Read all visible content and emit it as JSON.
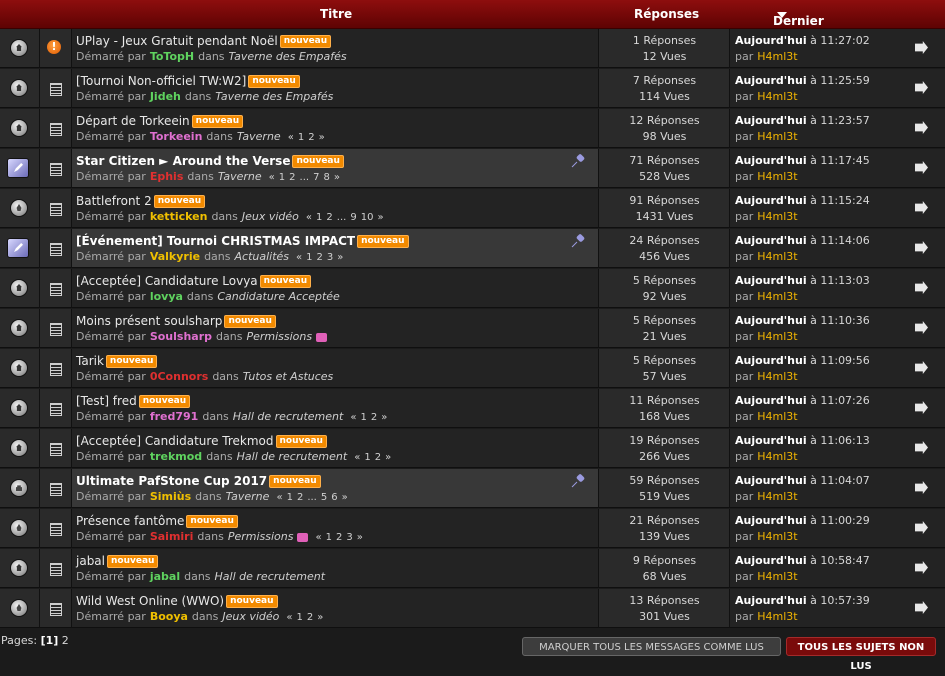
{
  "header": {
    "title": "Titre",
    "replies": "Réponses",
    "last": "Dernier message"
  },
  "labels": {
    "started_by": "Démarré par",
    "in": "dans",
    "new_badge": "nouveau",
    "today": "Aujourd'hui",
    "at": "à",
    "by": "par"
  },
  "colors": {
    "green": "#5fd35f",
    "pink": "#e070d0",
    "red": "#e03030",
    "yellow": "#f0c000",
    "gold": "#f0b400"
  },
  "topics": [
    {
      "title": "UPlay - Jeux Gratuit pendant Noël",
      "author": "ToTopH",
      "author_color": "green",
      "forum": "Taverne des Empafés",
      "pages": [],
      "replies": "1 Réponses",
      "views": "12 Vues",
      "time": "11:27:02",
      "user": "H4ml3t",
      "status_icon": "envelope-icon",
      "topic_icon": "alert-icon",
      "sticky": false
    },
    {
      "title": "[Tournoi Non-officiel TW:W2]",
      "author": "Jideh",
      "author_color": "green",
      "forum": "Taverne des Empafés",
      "pages": [],
      "replies": "7 Réponses",
      "views": "114 Vues",
      "time": "11:25:59",
      "user": "H4ml3t",
      "status_icon": "envelope-icon",
      "topic_icon": "doc-icon",
      "sticky": false
    },
    {
      "title": "Départ de Torkeein",
      "author": "Torkeein",
      "author_color": "pink",
      "forum": "Taverne",
      "pages": [
        "«",
        "1",
        "2",
        "»"
      ],
      "replies": "12 Réponses",
      "views": "98 Vues",
      "time": "11:23:57",
      "user": "H4ml3t",
      "status_icon": "envelope-icon",
      "topic_icon": "doc-icon",
      "sticky": false
    },
    {
      "title": "Star Citizen ► Around the Verse",
      "author": "Ephis",
      "author_color": "red",
      "forum": "Taverne",
      "pages": [
        "«",
        "1",
        "2",
        "...",
        "7",
        "8",
        "»"
      ],
      "replies": "71 Réponses",
      "views": "528 Vues",
      "time": "11:17:45",
      "user": "H4ml3t",
      "status_icon": "announce-icon",
      "topic_icon": "doc-icon",
      "sticky": true
    },
    {
      "title": "Battlefront 2",
      "author": "ketticken",
      "author_color": "yellow",
      "forum": "Jeux vidéo",
      "pages": [
        "«",
        "1",
        "2",
        "...",
        "9",
        "10",
        "»"
      ],
      "replies": "91 Réponses",
      "views": "1431 Vues",
      "time": "11:15:24",
      "user": "H4ml3t",
      "status_icon": "hot-icon",
      "topic_icon": "doc-icon",
      "sticky": false
    },
    {
      "title": "[Événement] Tournoi CHRISTMAS IMPACT",
      "author": "Valkyrie",
      "author_color": "yellow",
      "forum": "Actualités",
      "pages": [
        "«",
        "1",
        "2",
        "3",
        "»"
      ],
      "replies": "24 Réponses",
      "views": "456 Vues",
      "time": "11:14:06",
      "user": "H4ml3t",
      "status_icon": "announce-icon",
      "topic_icon": "doc-icon",
      "sticky": true
    },
    {
      "title": "[Acceptée] Candidature Lovya",
      "author": "lovya",
      "author_color": "green",
      "forum": "Candidature Acceptée",
      "pages": [],
      "replies": "5 Réponses",
      "views": "92 Vues",
      "time": "11:13:03",
      "user": "H4ml3t",
      "status_icon": "envelope-icon",
      "topic_icon": "doc-icon",
      "sticky": false
    },
    {
      "title": "Moins présent soulsharp",
      "author": "Soulsharp",
      "author_color": "pink",
      "forum": "Permissions",
      "folder": true,
      "pages": [],
      "replies": "5 Réponses",
      "views": "21 Vues",
      "time": "11:10:36",
      "user": "H4ml3t",
      "status_icon": "envelope-icon",
      "topic_icon": "doc-icon",
      "sticky": false
    },
    {
      "title": "Tarik",
      "author": "0Connors",
      "author_color": "red",
      "forum": "Tutos et Astuces",
      "pages": [],
      "replies": "5 Réponses",
      "views": "57 Vues",
      "time": "11:09:56",
      "user": "H4ml3t",
      "status_icon": "envelope-icon",
      "topic_icon": "doc-icon",
      "sticky": false
    },
    {
      "title": "[Test] fred",
      "author": "fred791",
      "author_color": "pink",
      "forum": "Hall de recrutement",
      "pages": [
        "«",
        "1",
        "2",
        "»"
      ],
      "replies": "11 Réponses",
      "views": "168 Vues",
      "time": "11:07:26",
      "user": "H4ml3t",
      "status_icon": "envelope-icon",
      "topic_icon": "doc-icon",
      "sticky": false
    },
    {
      "title": "[Acceptée] Candidature Trekmod",
      "author": "trekmod",
      "author_color": "green",
      "forum": "Hall de recrutement",
      "pages": [
        "«",
        "1",
        "2",
        "»"
      ],
      "replies": "19 Réponses",
      "views": "266 Vues",
      "time": "11:06:13",
      "user": "H4ml3t",
      "status_icon": "envelope-icon",
      "topic_icon": "doc-icon",
      "sticky": false
    },
    {
      "title": "Ultimate PafStone Cup 2017",
      "author": "Simiùs",
      "author_color": "yellow",
      "forum": "Taverne",
      "pages": [
        "«",
        "1",
        "2",
        "...",
        "5",
        "6",
        "»"
      ],
      "replies": "59 Réponses",
      "views": "519 Vues",
      "time": "11:04:07",
      "user": "H4ml3t",
      "status_icon": "locked-icon",
      "topic_icon": "doc-icon",
      "sticky": true
    },
    {
      "title": "Présence fantôme",
      "author": "Saimiri",
      "author_color": "red",
      "forum": "Permissions",
      "folder": true,
      "pages": [
        "«",
        "1",
        "2",
        "3",
        "»"
      ],
      "replies": "21 Réponses",
      "views": "139 Vues",
      "time": "11:00:29",
      "user": "H4ml3t",
      "status_icon": "hot-icon",
      "topic_icon": "doc-icon",
      "sticky": false
    },
    {
      "title": "jabal",
      "author": "jabal",
      "author_color": "green",
      "forum": "Hall de recrutement",
      "pages": [],
      "replies": "9 Réponses",
      "views": "68 Vues",
      "time": "10:58:47",
      "user": "H4ml3t",
      "status_icon": "envelope-icon",
      "topic_icon": "doc-icon",
      "sticky": false
    },
    {
      "title": "Wild West Online (WWO)",
      "author": "Booya",
      "author_color": "yellow",
      "forum": "Jeux vidéo",
      "pages": [
        "«",
        "1",
        "2",
        "»"
      ],
      "replies": "13 Réponses",
      "views": "301 Vues",
      "time": "10:57:39",
      "user": "H4ml3t",
      "status_icon": "hot-icon",
      "topic_icon": "doc-icon",
      "sticky": false
    }
  ],
  "footer": {
    "pages_label": "Pages:",
    "current_page": "[1]",
    "other_page": "2",
    "mark_all": "MARQUER TOUS LES MESSAGES COMME LUS",
    "unread": "TOUS LES SUJETS NON LUS"
  }
}
